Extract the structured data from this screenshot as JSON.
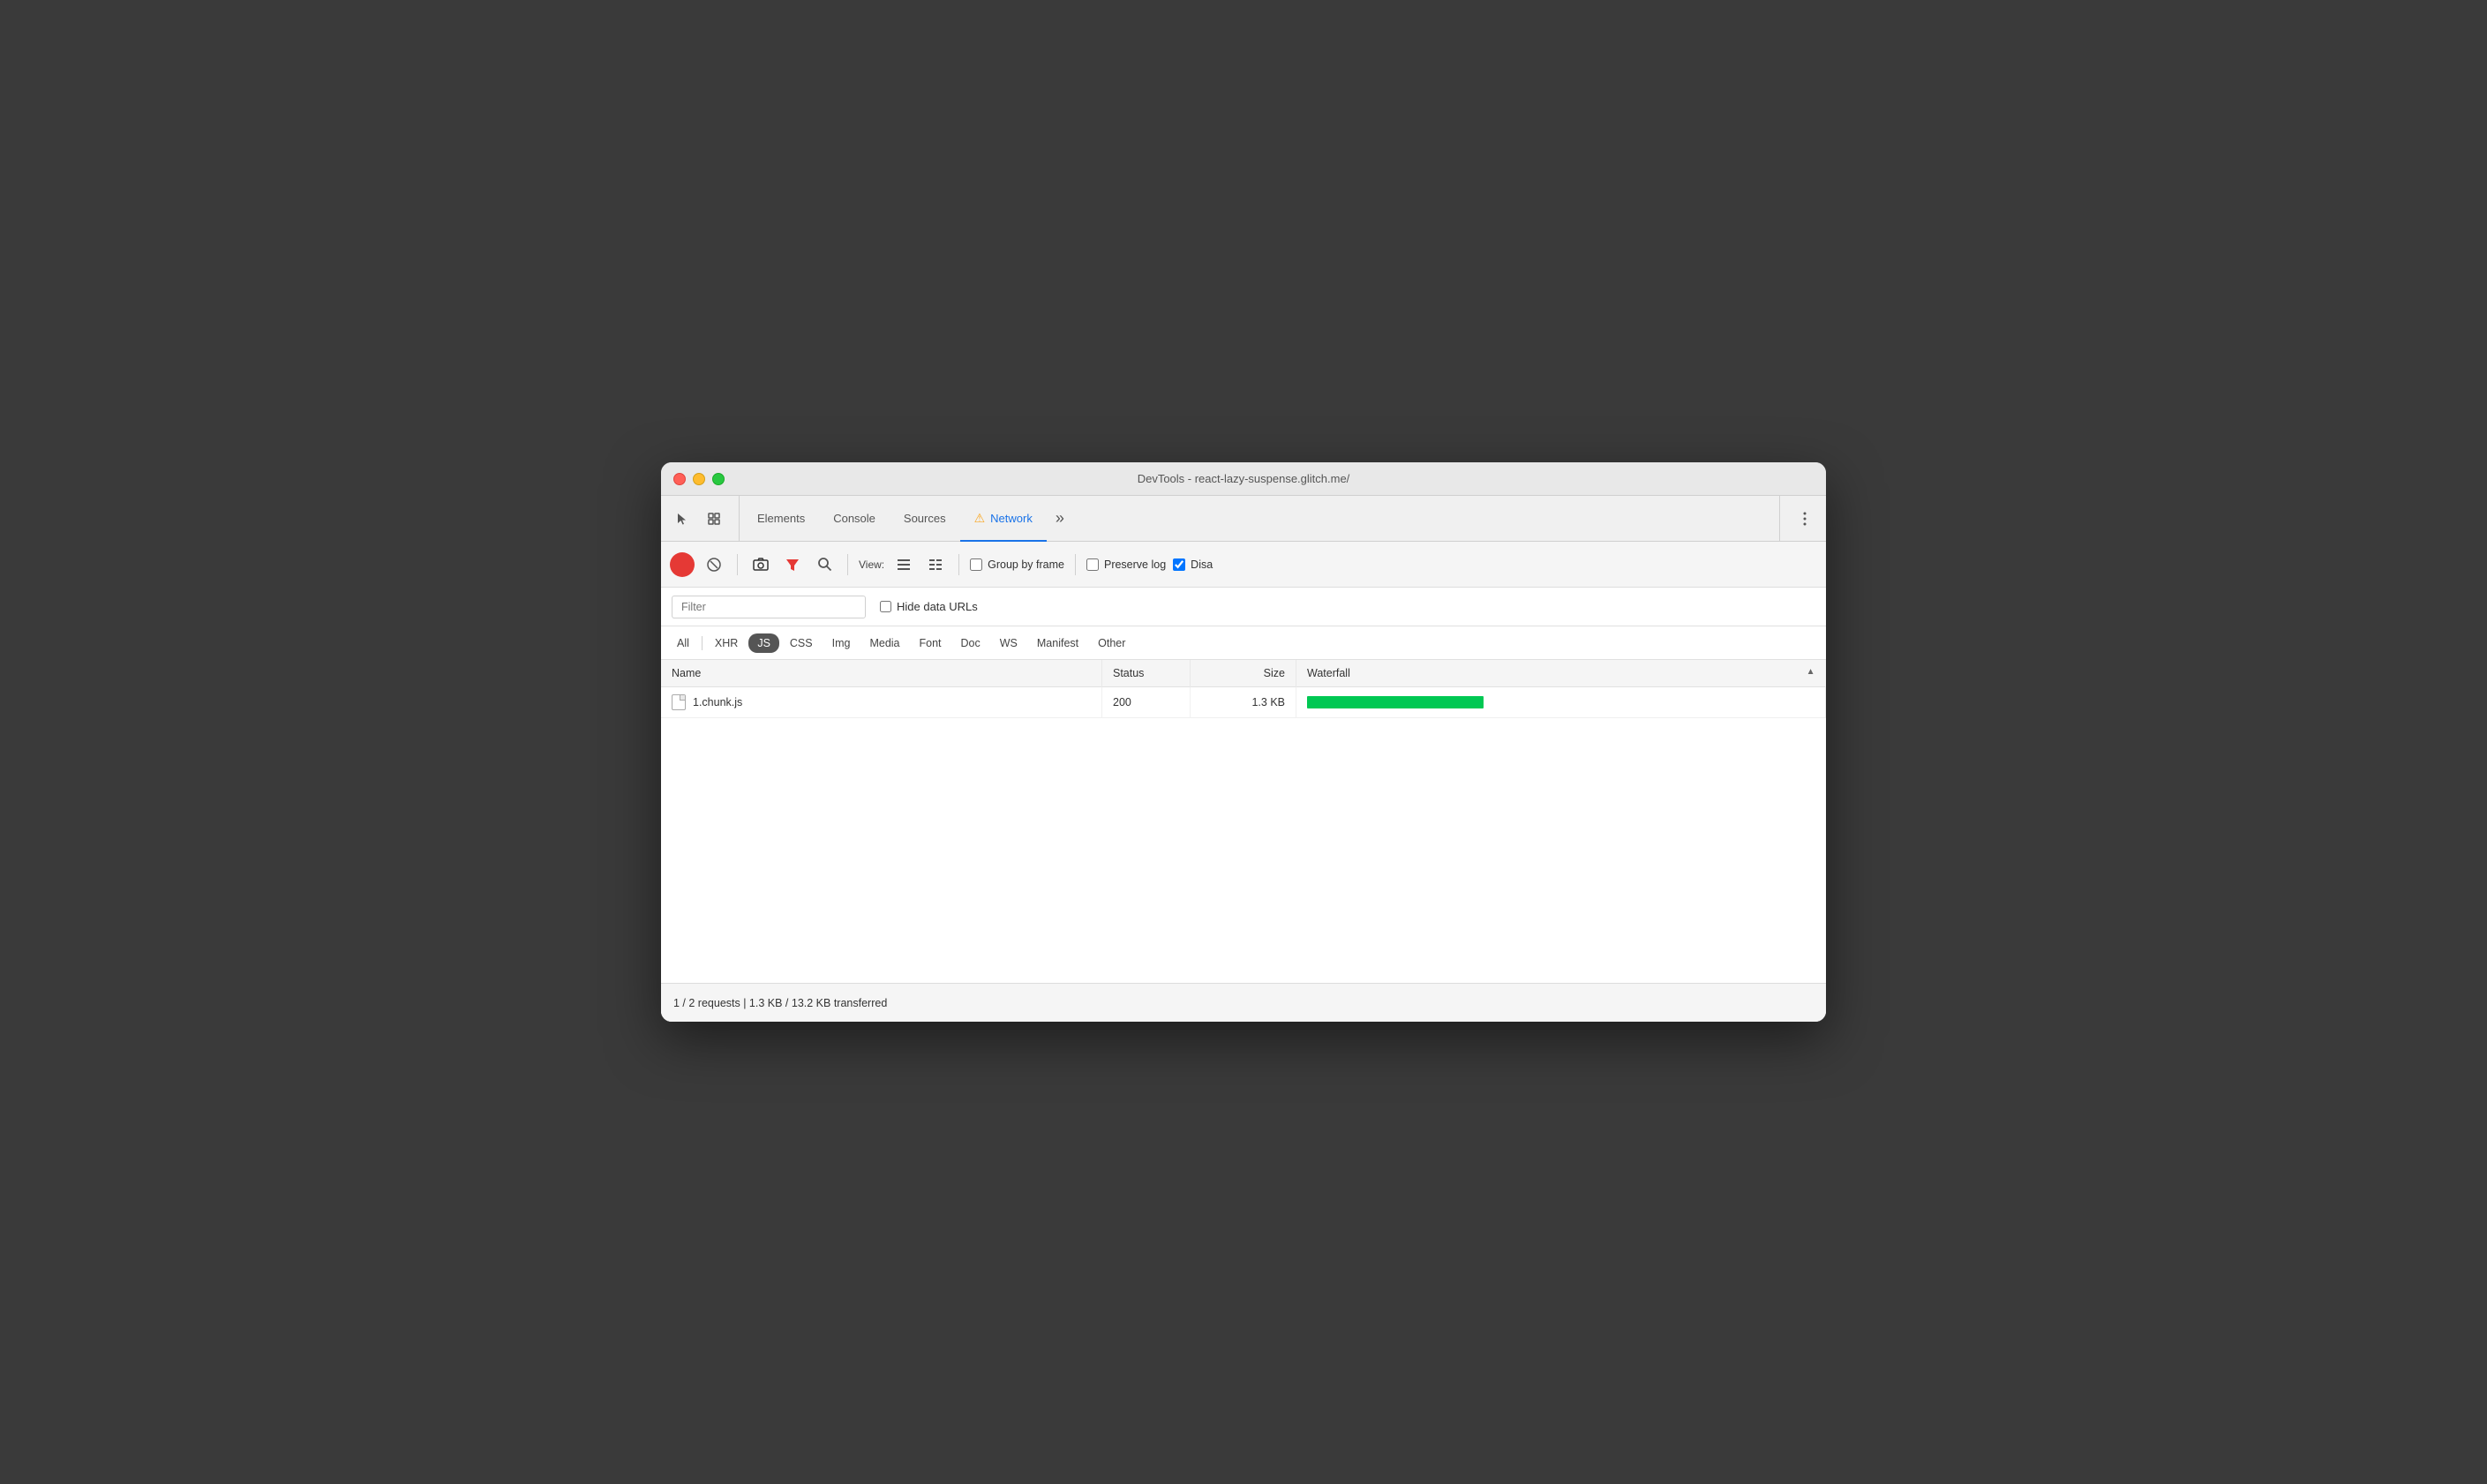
{
  "window": {
    "title": "DevTools - react-lazy-suspense.glitch.me/"
  },
  "tabs": [
    {
      "id": "elements",
      "label": "Elements",
      "active": false,
      "icon": null
    },
    {
      "id": "console",
      "label": "Console",
      "active": false,
      "icon": null
    },
    {
      "id": "sources",
      "label": "Sources",
      "active": false,
      "icon": null
    },
    {
      "id": "network",
      "label": "Network",
      "active": true,
      "icon": "warning"
    },
    {
      "id": "more",
      "label": "»",
      "active": false,
      "icon": null
    }
  ],
  "toolbar": {
    "record_label": "Record",
    "clear_label": "Clear",
    "camera_label": "Screenshot",
    "filter_label": "Filter",
    "search_label": "Search",
    "view_label": "View:",
    "group_by_frame_label": "Group by frame",
    "preserve_log_label": "Preserve log",
    "disable_cache_label": "Disa",
    "group_by_frame_checked": false,
    "preserve_log_checked": false,
    "disable_cache_checked": true
  },
  "filter": {
    "placeholder": "Filter",
    "value": "",
    "hide_data_urls_label": "Hide data URLs",
    "hide_data_urls_checked": false
  },
  "type_filters": [
    {
      "id": "all",
      "label": "All",
      "active": false
    },
    {
      "id": "xhr",
      "label": "XHR",
      "active": false
    },
    {
      "id": "js",
      "label": "JS",
      "active": true
    },
    {
      "id": "css",
      "label": "CSS",
      "active": false
    },
    {
      "id": "img",
      "label": "Img",
      "active": false
    },
    {
      "id": "media",
      "label": "Media",
      "active": false
    },
    {
      "id": "font",
      "label": "Font",
      "active": false
    },
    {
      "id": "doc",
      "label": "Doc",
      "active": false
    },
    {
      "id": "ws",
      "label": "WS",
      "active": false
    },
    {
      "id": "manifest",
      "label": "Manifest",
      "active": false
    },
    {
      "id": "other",
      "label": "Other",
      "active": false
    }
  ],
  "table": {
    "columns": [
      {
        "id": "name",
        "label": "Name"
      },
      {
        "id": "status",
        "label": "Status"
      },
      {
        "id": "size",
        "label": "Size"
      },
      {
        "id": "waterfall",
        "label": "Waterfall"
      }
    ],
    "rows": [
      {
        "name": "1.chunk.js",
        "status": "200",
        "size": "1.3 KB",
        "waterfall_width": 200
      }
    ]
  },
  "status_bar": {
    "text": "1 / 2 requests | 1.3 KB / 13.2 KB transferred"
  },
  "colors": {
    "waterfall_bar": "#00c853",
    "active_tab_underline": "#1a73e8",
    "js_badge_bg": "#555",
    "record_red": "#e53935",
    "warning_yellow": "#f9a825"
  }
}
